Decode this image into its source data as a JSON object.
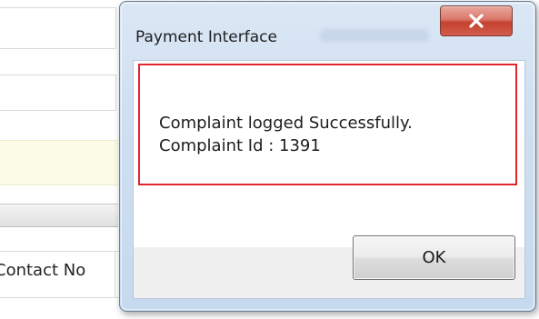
{
  "background": {
    "contact_label": "Contact No"
  },
  "dialog": {
    "title": "Payment Interface",
    "message_line1": "Complaint logged Successfully.",
    "message_line2": "Complaint Id : 1391",
    "ok_label": "OK",
    "close_icon": "close-icon",
    "highlight_color": "#e3262e",
    "close_button_color": "#c4412f"
  }
}
